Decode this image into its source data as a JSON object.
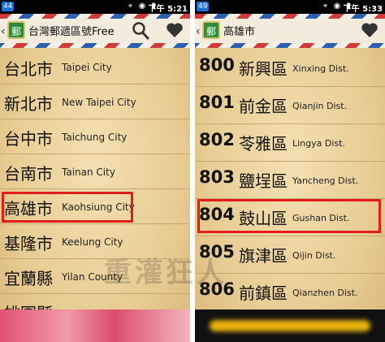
{
  "left": {
    "status": {
      "notif": "44",
      "icons": "⌖ ◉ ▮",
      "time": "下午 5:21"
    },
    "appbar": {
      "title": "台灣郵遞區號Free",
      "logo_text": "郵"
    },
    "cities": [
      {
        "zh": "台北市",
        "en": "Taipei City"
      },
      {
        "zh": "新北市",
        "en": "New Taipei City"
      },
      {
        "zh": "台中市",
        "en": "Taichung City"
      },
      {
        "zh": "台南市",
        "en": "Tainan City"
      },
      {
        "zh": "高雄市",
        "en": "Kaohsiung City"
      },
      {
        "zh": "基隆市",
        "en": "Keelung City"
      },
      {
        "zh": "宜蘭縣",
        "en": "Yilan County"
      },
      {
        "zh": "桃園縣",
        "en": ""
      }
    ],
    "highlighted_index": 4
  },
  "right": {
    "status": {
      "notif": "49",
      "icons": "⌖ ◉ ▮",
      "time": "下午 5:33"
    },
    "appbar": {
      "title": "高雄市",
      "logo_text": "郵"
    },
    "districts": [
      {
        "code": "800",
        "zh": "新興區",
        "en": "Xinxing Dist."
      },
      {
        "code": "801",
        "zh": "前金區",
        "en": "Qianjin Dist."
      },
      {
        "code": "802",
        "zh": "苓雅區",
        "en": "Lingya Dist."
      },
      {
        "code": "803",
        "zh": "鹽埕區",
        "en": "Yancheng Dist."
      },
      {
        "code": "804",
        "zh": "鼓山區",
        "en": "Gushan Dist."
      },
      {
        "code": "805",
        "zh": "旗津區",
        "en": "Qijin Dist."
      },
      {
        "code": "806",
        "zh": "前鎮區",
        "en": "Qianzhen Dist."
      }
    ],
    "highlighted_index": 4
  },
  "watermark": "重灌狂人",
  "icons": {
    "search": "search-icon",
    "favorite": "heart-icon",
    "back": "back-icon"
  },
  "colors": {
    "highlight": "#e21b1b",
    "parchment": "#e8cd94"
  }
}
